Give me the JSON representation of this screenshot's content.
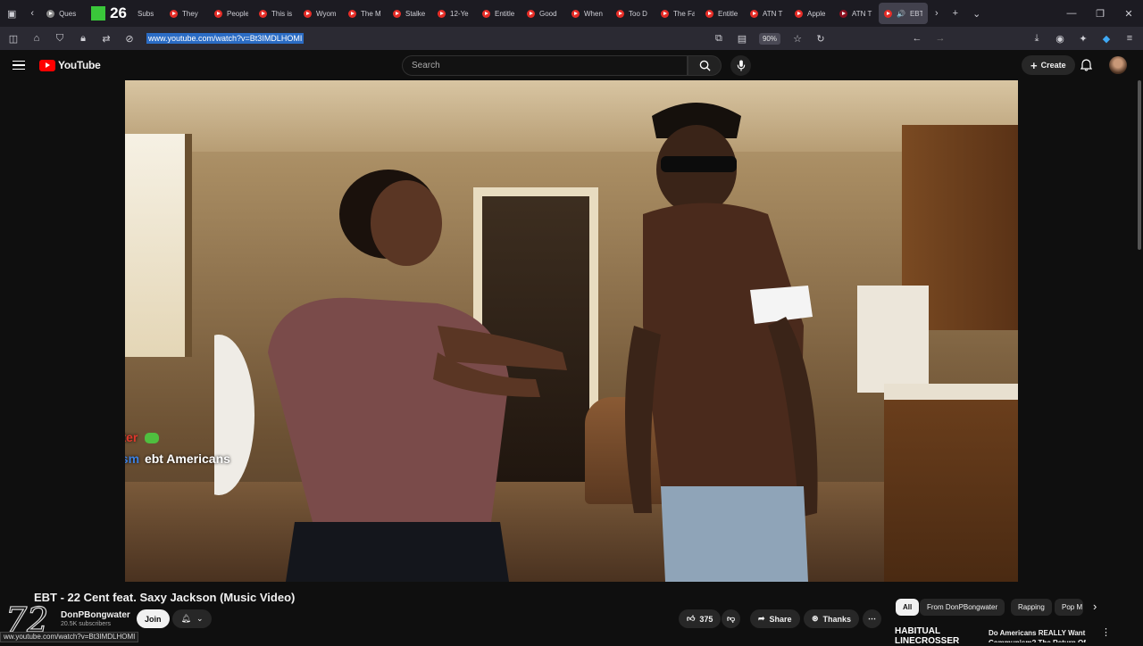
{
  "browser": {
    "tabs": [
      {
        "label": "Ques"
      },
      {
        "label": "26"
      },
      {
        "label": "Subs"
      },
      {
        "label": "They"
      },
      {
        "label": "People"
      },
      {
        "label": "This is"
      },
      {
        "label": "Wyom"
      },
      {
        "label": "The M"
      },
      {
        "label": "Stalke"
      },
      {
        "label": "12-Ye"
      },
      {
        "label": "Entitle"
      },
      {
        "label": "Good"
      },
      {
        "label": "When"
      },
      {
        "label": "Too D"
      },
      {
        "label": "The Fa"
      },
      {
        "label": "Entitle"
      },
      {
        "label": "ATN T"
      },
      {
        "label": "Apple"
      },
      {
        "label": "ATN T"
      },
      {
        "label": "EBT"
      }
    ],
    "url": "www.youtube.com/watch?v=Bt3IMDLHOMI",
    "zoom": "90%",
    "status_url": "ww.youtube.com/watch?v=Bt3IMDLHOMI"
  },
  "youtube": {
    "logo_text": "YouTube",
    "search_placeholder": "Search",
    "create_label": "Create"
  },
  "video": {
    "title": "EBT - 22 Cent feat. Saxy Jackson (Music Video)",
    "chat": [
      {
        "user": "ItsJKHunter",
        "user_color": "#e0382c",
        "message": ""
      },
      {
        "user": "Mr_paroxysm",
        "user_color": "#3b7fe0",
        "message": "ebt Americans"
      }
    ]
  },
  "channel": {
    "name": "DonPBongwater",
    "subscribers": "20.5K subscribers",
    "join_label": "Join"
  },
  "actions": {
    "likes": "375",
    "share_label": "Share",
    "thanks_label": "Thanks"
  },
  "chips": [
    "All",
    "From DonPBongwater",
    "Rapping",
    "Pop M"
  ],
  "recommendation": {
    "thumb_text": "HABITUAL LINECROSSER",
    "title": "Do Americans REALLY Want Communism? The Return Of"
  },
  "colors": {
    "accent": "#ff0000",
    "background": "#0f0f0f",
    "url_highlight": "#2b6cc4"
  }
}
